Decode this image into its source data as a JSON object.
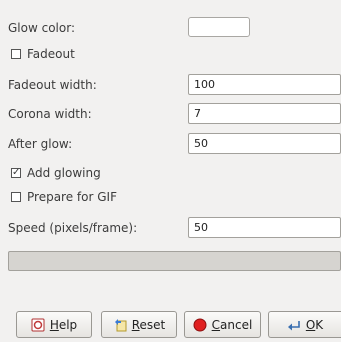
{
  "glow_color": {
    "label": "Glow color:",
    "value": "#ffffff"
  },
  "fadeout": {
    "label": "Fadeout",
    "checked": false
  },
  "fadeout_width": {
    "label": "Fadeout width:",
    "value": "100"
  },
  "corona_width": {
    "label": "Corona width:",
    "value": "7"
  },
  "after_glow": {
    "label": "After glow:",
    "value": "50"
  },
  "add_glowing": {
    "label": "Add glowing",
    "checked": true
  },
  "prepare_gif": {
    "label": "Prepare for GIF",
    "checked": false
  },
  "speed": {
    "label": "Speed (pixels/frame):",
    "value": "50"
  },
  "progress": {
    "fraction": 0
  },
  "buttons": {
    "help": {
      "mnemonic": "H",
      "rest": "elp",
      "icon": "help-icon"
    },
    "reset": {
      "mnemonic": "R",
      "rest": "eset",
      "icon": "reset-icon"
    },
    "cancel": {
      "mnemonic": "C",
      "rest": "ancel",
      "icon": "cancel-icon"
    },
    "ok": {
      "mnemonic": "O",
      "rest": "K",
      "icon": "ok-icon"
    }
  }
}
